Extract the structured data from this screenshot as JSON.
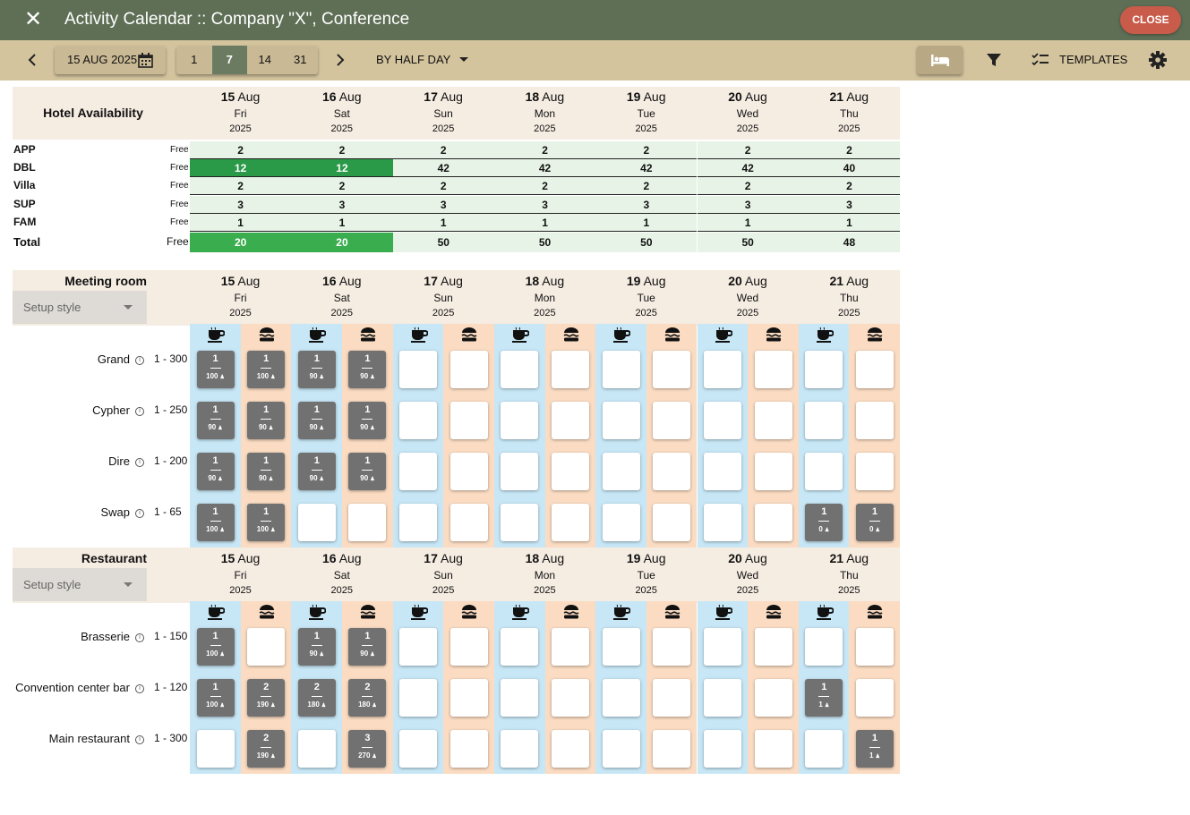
{
  "window": {
    "title": "Activity Calendar :: Company \"X\", Conference",
    "close_label": "CLOSE"
  },
  "toolbar": {
    "date": "15 AUG 2025",
    "ranges": [
      "1",
      "7",
      "14",
      "31"
    ],
    "selected_range": "7",
    "granularity": "BY HALF DAY",
    "templates_label": "TEMPLATES"
  },
  "days": [
    {
      "num": "15",
      "mon": "Aug",
      "dow": "Fri",
      "year": "2025"
    },
    {
      "num": "16",
      "mon": "Aug",
      "dow": "Sat",
      "year": "2025"
    },
    {
      "num": "17",
      "mon": "Aug",
      "dow": "Sun",
      "year": "2025"
    },
    {
      "num": "18",
      "mon": "Aug",
      "dow": "Mon",
      "year": "2025"
    },
    {
      "num": "19",
      "mon": "Aug",
      "dow": "Tue",
      "year": "2025"
    },
    {
      "num": "20",
      "mon": "Aug",
      "dow": "Wed",
      "year": "2025"
    },
    {
      "num": "21",
      "mon": "Aug",
      "dow": "Thu",
      "year": "2025"
    }
  ],
  "hotel": {
    "title": "Hotel Availability",
    "free_label": "Free",
    "rows": [
      {
        "label": "APP",
        "values": [
          "2",
          "2",
          "2",
          "2",
          "2",
          "2",
          "2"
        ],
        "highlight": [
          0,
          0,
          0,
          0,
          0,
          0,
          0
        ]
      },
      {
        "label": "DBL",
        "values": [
          "12",
          "12",
          "42",
          "42",
          "42",
          "42",
          "40"
        ],
        "highlight": [
          1,
          1,
          0,
          0,
          0,
          0,
          0
        ]
      },
      {
        "label": "Villa",
        "values": [
          "2",
          "2",
          "2",
          "2",
          "2",
          "2",
          "2"
        ],
        "highlight": [
          0,
          0,
          0,
          0,
          0,
          0,
          0
        ]
      },
      {
        "label": "SUP",
        "values": [
          "3",
          "3",
          "3",
          "3",
          "3",
          "3",
          "3"
        ],
        "highlight": [
          0,
          0,
          0,
          0,
          0,
          0,
          0
        ]
      },
      {
        "label": "FAM",
        "values": [
          "1",
          "1",
          "1",
          "1",
          "1",
          "1",
          "1"
        ],
        "highlight": [
          0,
          0,
          0,
          0,
          0,
          0,
          0
        ]
      }
    ],
    "total": {
      "label": "Total",
      "values": [
        "20",
        "20",
        "50",
        "50",
        "50",
        "50",
        "48"
      ],
      "highlight": [
        1,
        1,
        0,
        0,
        0,
        0,
        0
      ]
    }
  },
  "sections": [
    {
      "title": "Meeting room",
      "setup_placeholder": "Setup style",
      "rooms": [
        {
          "name": "Grand",
          "capacity": "1 - 300",
          "cells": [
            [
              "1",
              "100"
            ],
            [
              "1",
              "100"
            ],
            [
              "1",
              "90"
            ],
            [
              "1",
              "90"
            ],
            null,
            null,
            null,
            null,
            null,
            null,
            null,
            null,
            null,
            null
          ]
        },
        {
          "name": "Cypher",
          "capacity": "1 - 250",
          "cells": [
            [
              "1",
              "90"
            ],
            [
              "1",
              "90"
            ],
            [
              "1",
              "90"
            ],
            [
              "1",
              "90"
            ],
            null,
            null,
            null,
            null,
            null,
            null,
            null,
            null,
            null,
            null
          ]
        },
        {
          "name": "Dire",
          "capacity": "1 - 200",
          "cells": [
            [
              "1",
              "90"
            ],
            [
              "1",
              "90"
            ],
            [
              "1",
              "90"
            ],
            [
              "1",
              "90"
            ],
            null,
            null,
            null,
            null,
            null,
            null,
            null,
            null,
            null,
            null
          ]
        },
        {
          "name": "Swap",
          "capacity": "1 - 65",
          "cells": [
            [
              "1",
              "100"
            ],
            [
              "1",
              "100"
            ],
            null,
            null,
            null,
            null,
            null,
            null,
            null,
            null,
            null,
            null,
            [
              "1",
              "0"
            ],
            [
              "1",
              "0"
            ]
          ]
        }
      ]
    },
    {
      "title": "Restaurant",
      "setup_placeholder": "Setup style",
      "rooms": [
        {
          "name": "Brasserie",
          "capacity": "1 - 150",
          "cells": [
            [
              "1",
              "100"
            ],
            null,
            [
              "1",
              "90"
            ],
            [
              "1",
              "90"
            ],
            null,
            null,
            null,
            null,
            null,
            null,
            null,
            null,
            null,
            null
          ]
        },
        {
          "name": "Convention center bar",
          "capacity": "1 - 120",
          "cells": [
            [
              "1",
              "100"
            ],
            [
              "2",
              "190"
            ],
            [
              "2",
              "180"
            ],
            [
              "2",
              "180"
            ],
            null,
            null,
            null,
            null,
            null,
            null,
            null,
            null,
            [
              "1",
              "1"
            ],
            null
          ]
        },
        {
          "name": "Main restaurant",
          "capacity": "1 - 300",
          "cells": [
            null,
            [
              "2",
              "190"
            ],
            null,
            [
              "3",
              "270"
            ],
            null,
            null,
            null,
            null,
            null,
            null,
            null,
            null,
            null,
            [
              "1",
              "1"
            ]
          ]
        }
      ]
    }
  ],
  "slot_icons": [
    "coffee-icon",
    "burger-icon"
  ],
  "colors": {
    "topbar": "#5f6f56",
    "toolbar": "#d4c49e",
    "close": "#c85b4a",
    "morning": "#c7e7f6",
    "afternoon": "#fbdcc2",
    "occupied": "#717171",
    "free_green": "#2b9a48"
  }
}
